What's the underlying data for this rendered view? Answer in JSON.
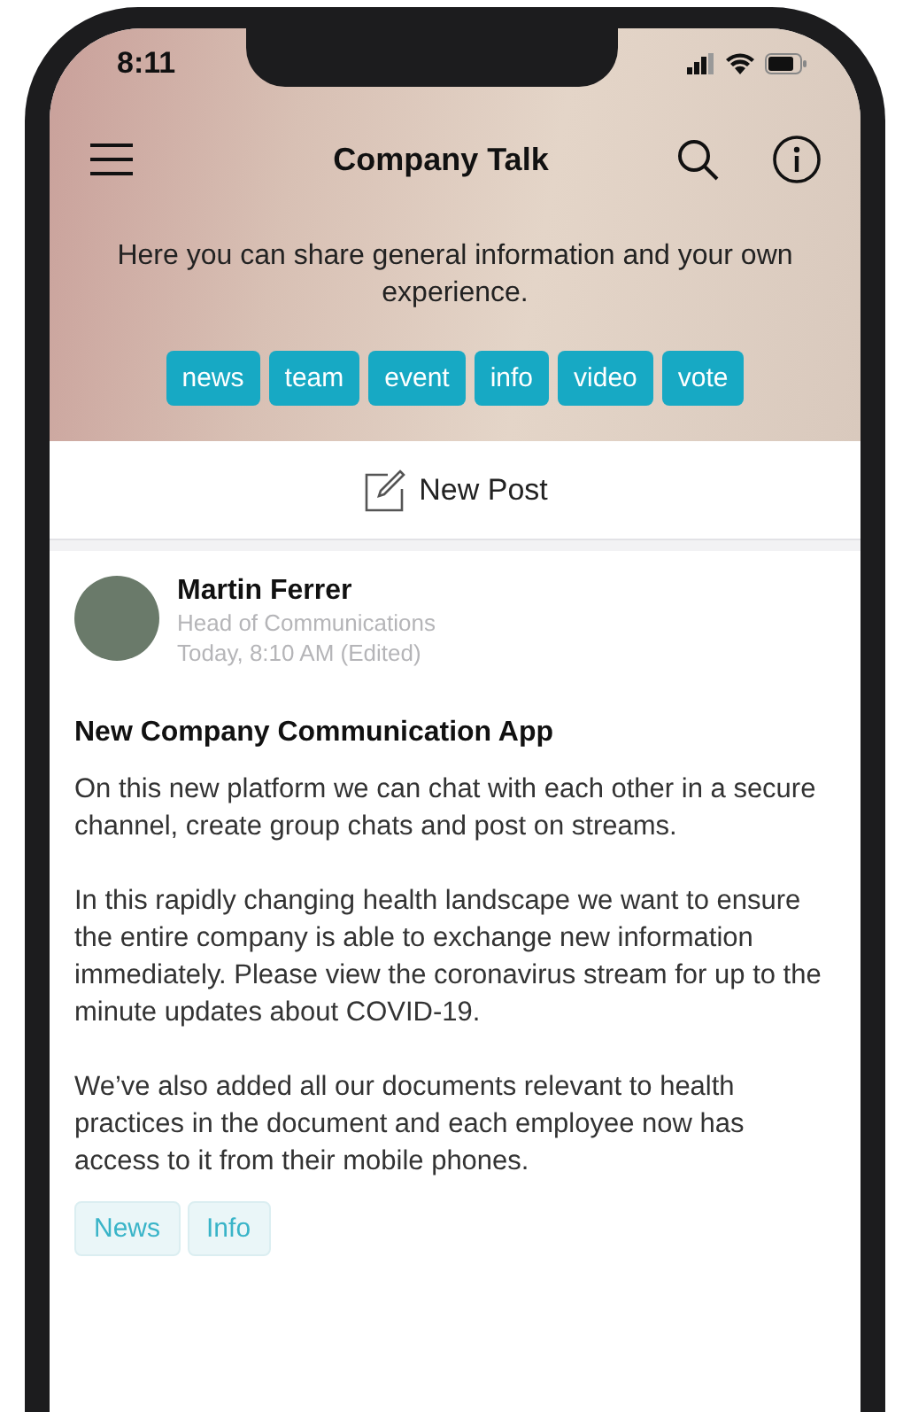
{
  "status_bar": {
    "time": "8:11"
  },
  "header": {
    "title": "Company Talk",
    "description": "Here you can share general information and your own experience.",
    "chips": [
      {
        "label": "news"
      },
      {
        "label": "team"
      },
      {
        "label": "event"
      },
      {
        "label": "info"
      },
      {
        "label": "video"
      },
      {
        "label": "vote"
      }
    ]
  },
  "new_post": {
    "label": "New Post"
  },
  "post": {
    "author": "Martin Ferrer",
    "role": "Head of Communications",
    "time": "Today, 8:10 AM (Edited)",
    "title": "New Company Communication App",
    "paragraphs": [
      "On this new platform we can chat with each other in a secure channel, create group chats and post on streams.",
      "In this rapidly changing health landscape we want to ensure the entire company is able to exchange new information immediately. Please view the coronavirus stream for up to the minute updates about COVID-19.",
      "We’ve also added all our documents relevant to health practices in the document and each employee now has access to it from their mobile phones."
    ],
    "tags": [
      {
        "label": "News"
      },
      {
        "label": "Info"
      }
    ]
  }
}
